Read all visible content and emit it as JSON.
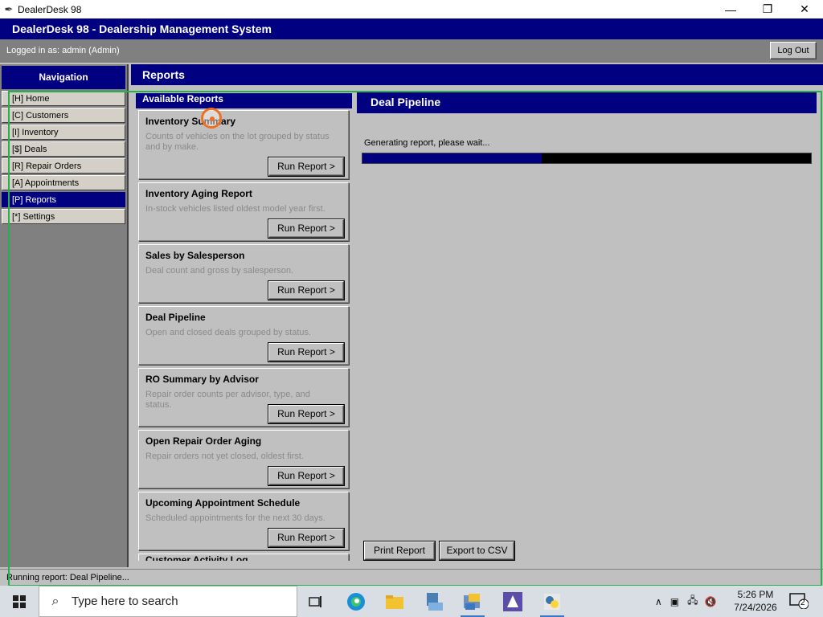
{
  "window": {
    "title": "DealerDesk 98",
    "minimize": "—",
    "restore": "❐",
    "close": "✕"
  },
  "app": {
    "header": "DealerDesk 98 - Dealership Management System",
    "logged_in": "Logged in as: admin (Admin)",
    "logout_label": "Log Out"
  },
  "nav": {
    "title": "Navigation",
    "items": [
      {
        "label": "[H]  Home"
      },
      {
        "label": "[C]  Customers"
      },
      {
        "label": "[I]  Inventory"
      },
      {
        "label": "[$]  Deals"
      },
      {
        "label": "[R]  Repair Orders"
      },
      {
        "label": "[A]  Appointments"
      },
      {
        "label": "[P]  Reports"
      },
      {
        "label": "[*]  Settings"
      }
    ],
    "selected_index": 6
  },
  "reports": {
    "header": "Reports",
    "available_title": "Available Reports",
    "run_label": "Run Report >",
    "cards": [
      {
        "name": "Inventory Summary",
        "desc": "Counts of vehicles on the lot grouped by status and by make."
      },
      {
        "name": "Inventory Aging Report",
        "desc": "In-stock vehicles listed oldest model year first."
      },
      {
        "name": "Sales by Salesperson",
        "desc": "Deal count and gross by salesperson."
      },
      {
        "name": "Deal Pipeline",
        "desc": "Open and closed deals grouped by status."
      },
      {
        "name": "RO Summary by Advisor",
        "desc": "Repair order counts per advisor, type, and status."
      },
      {
        "name": "Open Repair Order Aging",
        "desc": "Repair orders not yet closed, oldest first."
      },
      {
        "name": "Upcoming Appointment Schedule",
        "desc": "Scheduled appointments for the next 30 days."
      },
      {
        "name": "Customer Activity Log",
        "desc": ""
      }
    ]
  },
  "pipeline": {
    "title": "Deal Pipeline",
    "status_text": "Generating report, please wait...",
    "progress_fraction": 0.4,
    "print_label": "Print Report",
    "export_label": "Export to CSV"
  },
  "statusbar": {
    "text": "Running report: Deal Pipeline..."
  },
  "taskbar": {
    "search_placeholder": "Type here to search",
    "time": "5:26 PM",
    "date": "7/24/2026",
    "notification_count": "2"
  }
}
